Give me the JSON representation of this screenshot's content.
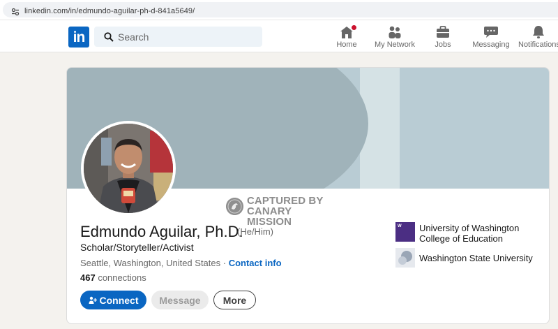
{
  "browser": {
    "url": "linkedin.com/in/edmundo-aguilar-ph-d-841a5649/"
  },
  "nav": {
    "logo_text": "in",
    "search_placeholder": "Search",
    "items": [
      {
        "label": "Home",
        "icon": "home-icon"
      },
      {
        "label": "My Network",
        "icon": "network-icon"
      },
      {
        "label": "Jobs",
        "icon": "briefcase-icon"
      },
      {
        "label": "Messaging",
        "icon": "messaging-icon"
      },
      {
        "label": "Notifications",
        "icon": "bell-icon"
      }
    ]
  },
  "stamp": {
    "line1": "CAPTURED BY",
    "line2": "CANARY MISSION"
  },
  "profile": {
    "name": "Edmundo Aguilar, Ph.D.",
    "pronouns": "(He/Him)",
    "headline": "Scholar/Storyteller/Activist",
    "location": "Seattle, Washington, United States",
    "separator": " · ",
    "contact_info": "Contact info",
    "connections_count": "467",
    "connections_label": " connections"
  },
  "actions": {
    "connect": "Connect",
    "message": "Message",
    "more": "More"
  },
  "education": [
    {
      "name_line1": "University of Washington",
      "name_line2": "College of Education",
      "logo_text": "W"
    },
    {
      "name": "Washington State University"
    }
  ],
  "colors": {
    "brand_blue": "#0a66c2",
    "banner": "#b9ccd4",
    "notification_red": "#cb112d"
  }
}
